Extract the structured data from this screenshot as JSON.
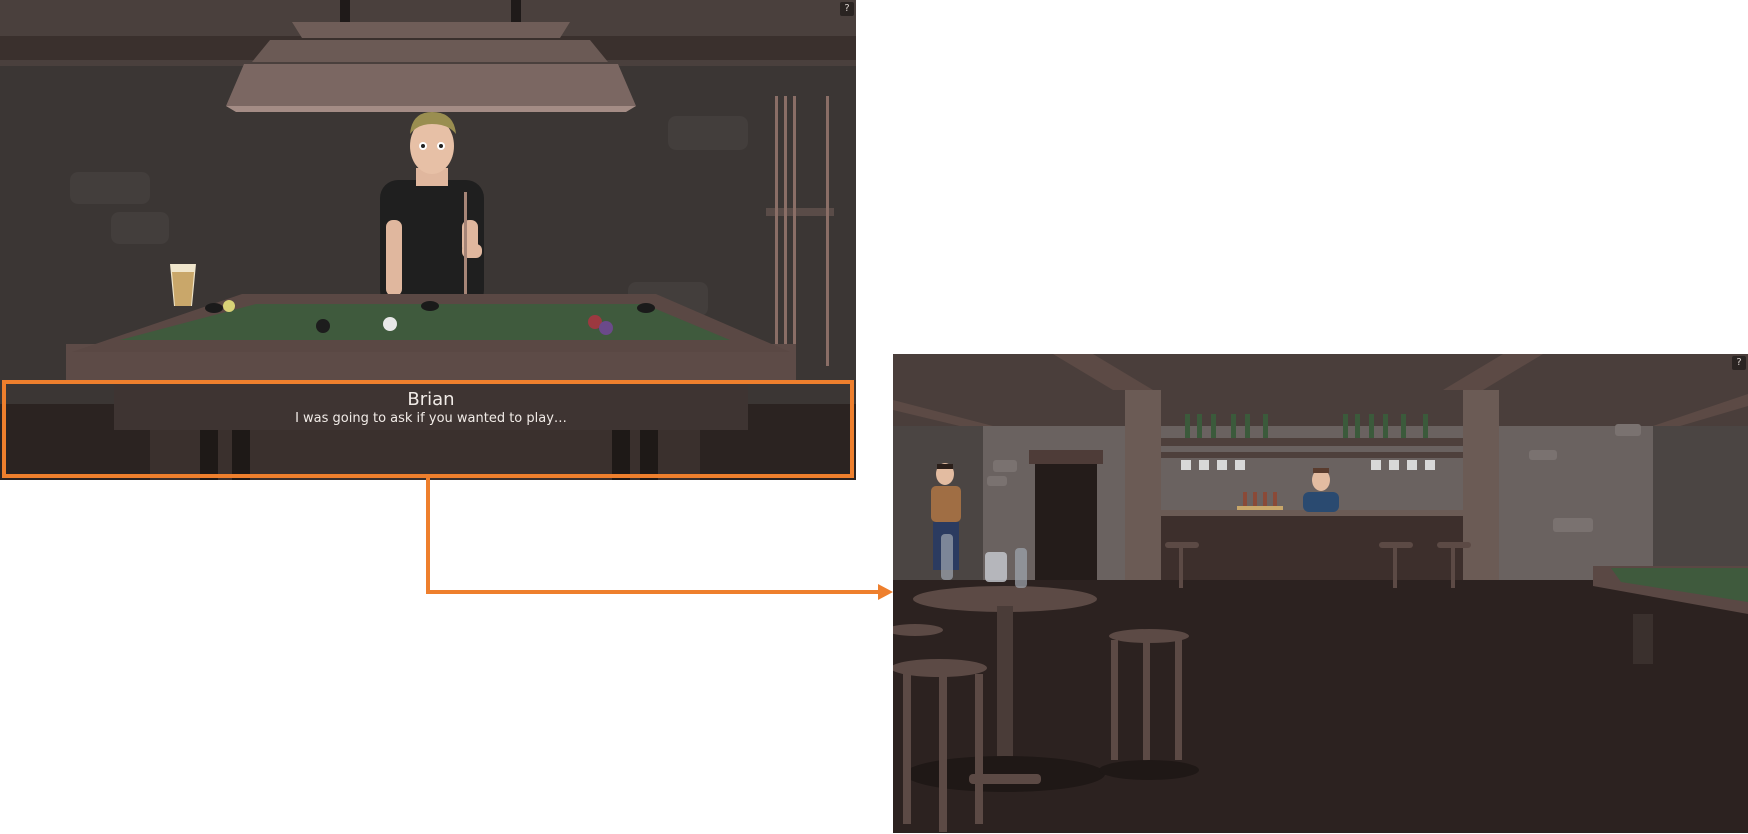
{
  "pool_scene": {
    "help_label": "?",
    "dialogue": {
      "speaker": "Brian",
      "line": "I was going to ask if you wanted to play…"
    }
  },
  "bar_scene": {
    "help_label": "?"
  },
  "colors": {
    "highlight": "#ee7f2d",
    "table_felt": "#3f5a3d",
    "wall": "#3b3634",
    "floor": "#2c2220"
  },
  "icons": {
    "help": "question-mark-icon",
    "connector": "arrow-right-icon"
  }
}
